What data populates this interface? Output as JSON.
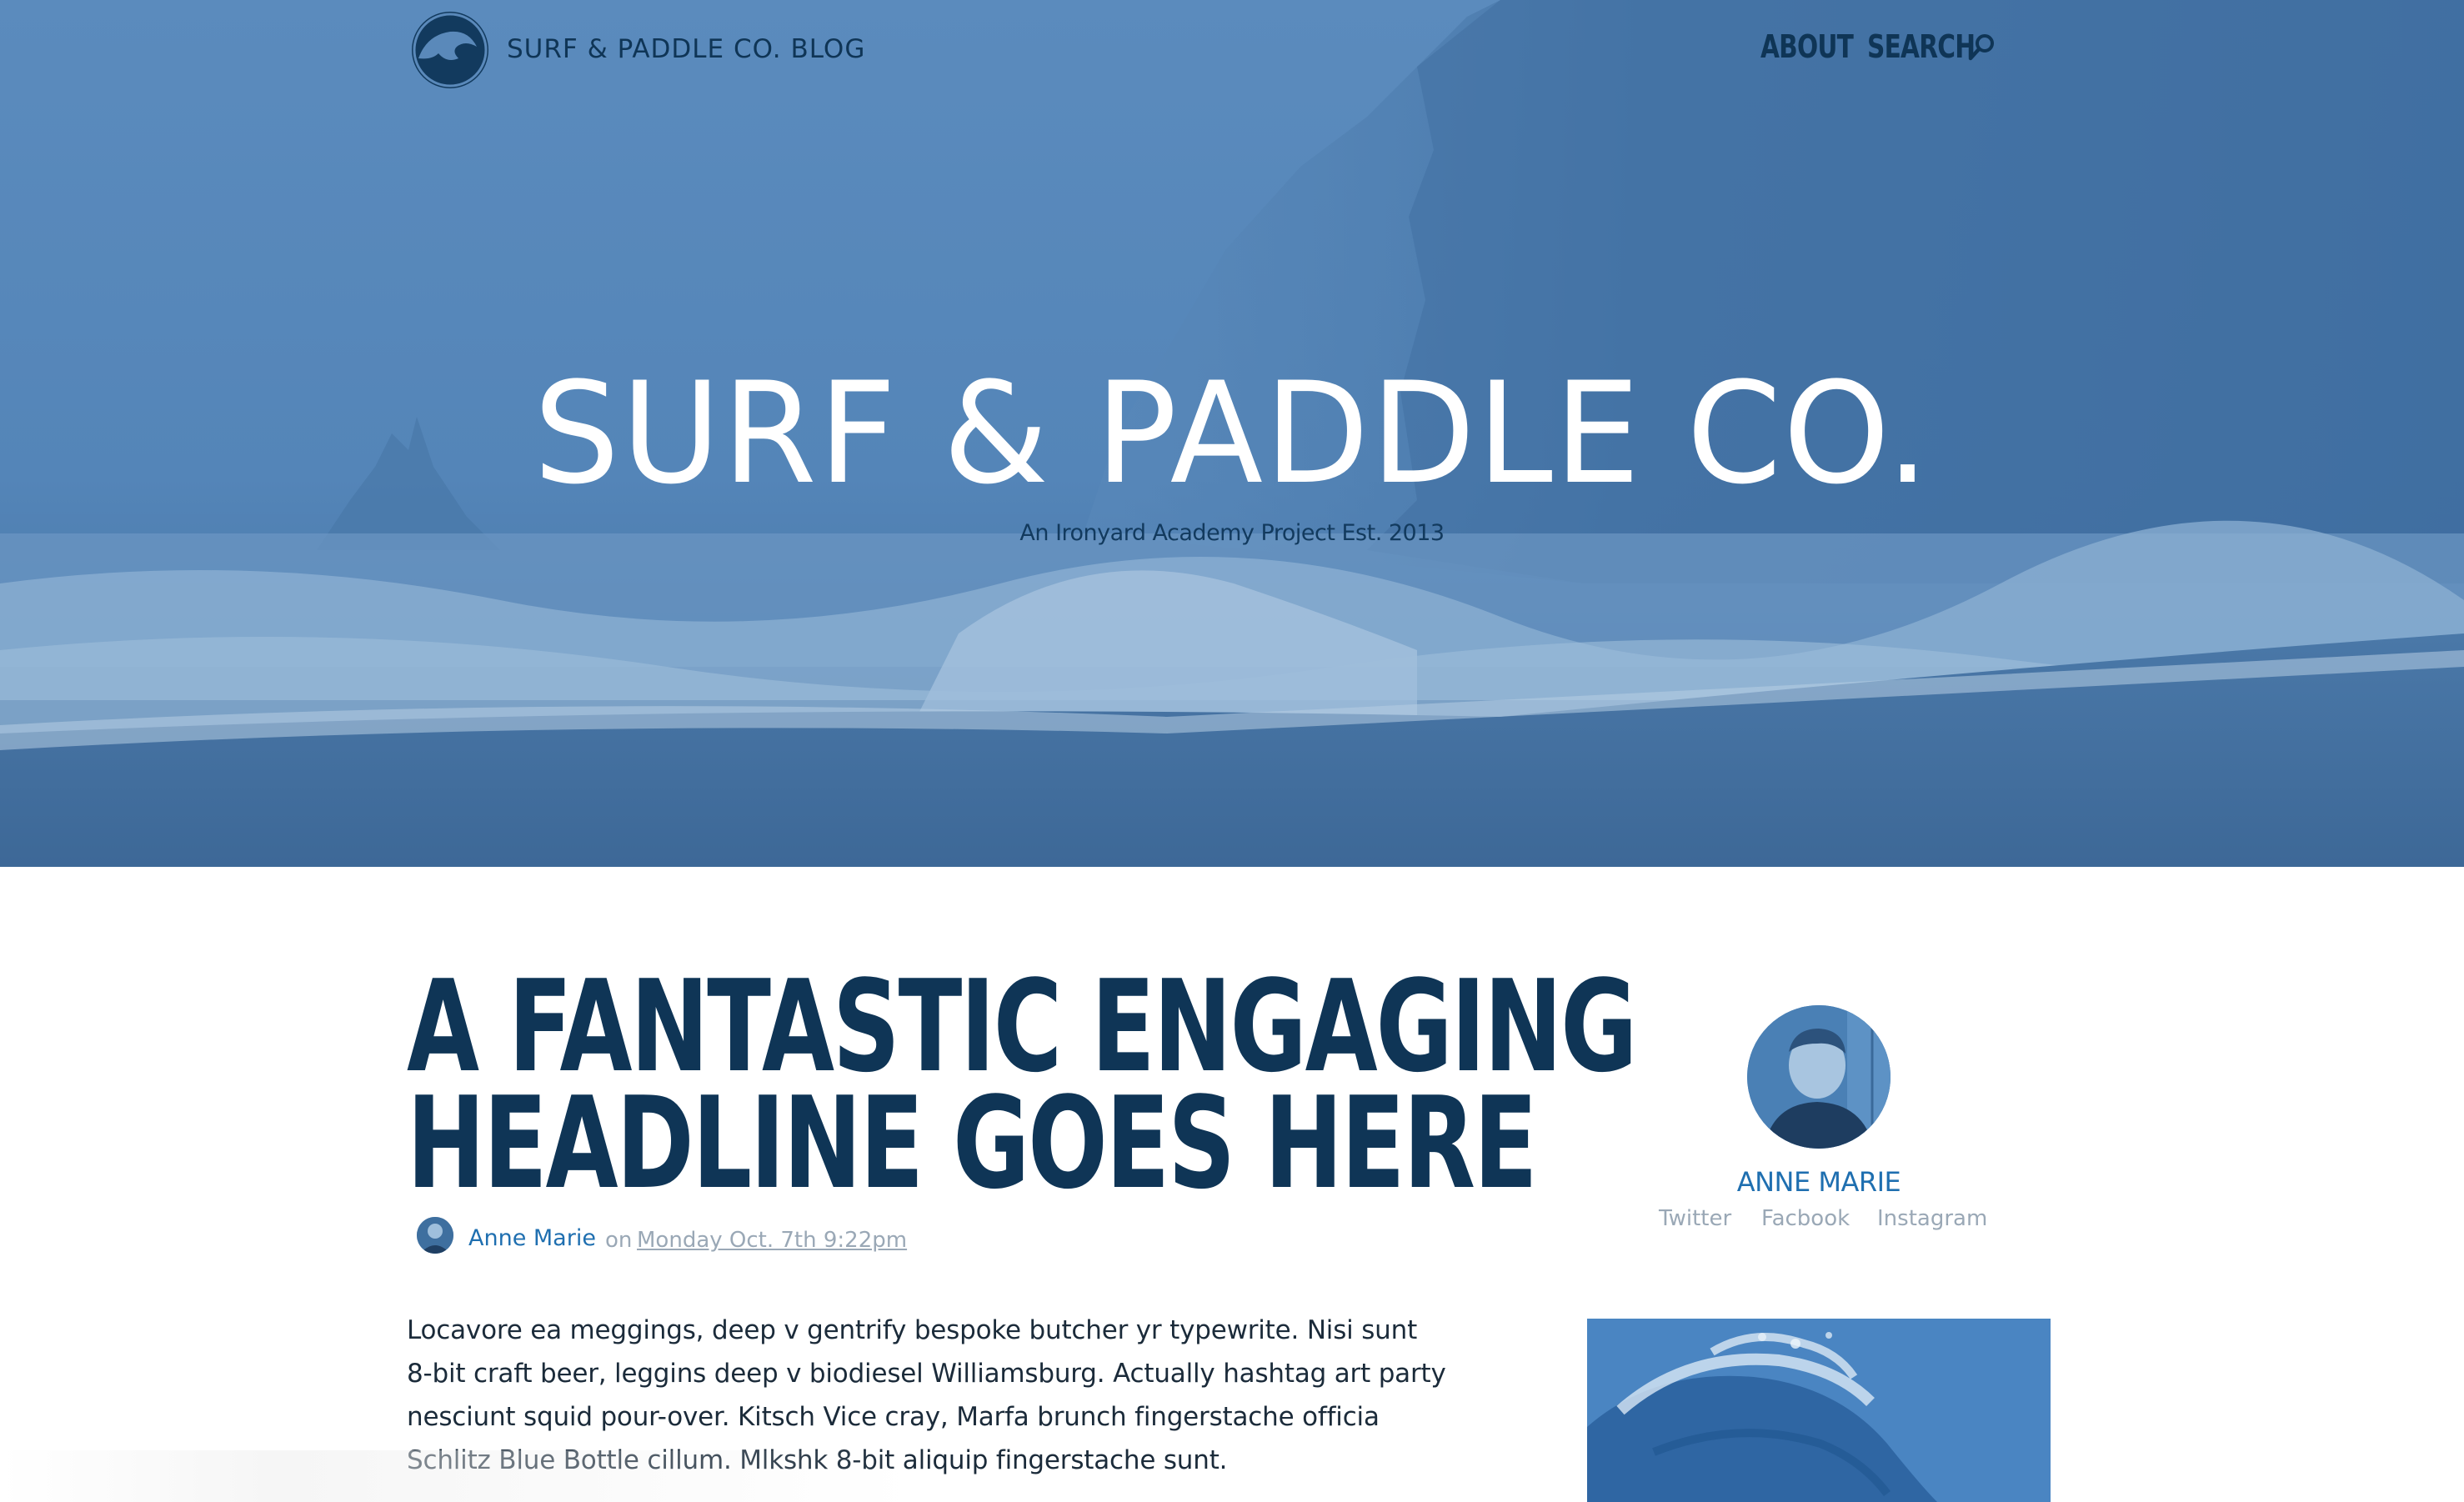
{
  "header": {
    "brand": "SURF & PADDLE CO. BLOG",
    "nav": {
      "about": "ABOUT",
      "search": "SEARCH"
    },
    "icons": {
      "logo": "wave-logo-icon",
      "search": "search-icon"
    }
  },
  "hero": {
    "title": "SURF & PADDLE CO.",
    "subtitle": "An Ironyard Academy Project Est. 2013"
  },
  "article": {
    "headline_line1": "A FANTASTIC ENGAGING",
    "headline_line2": "HEADLINE GOES HERE",
    "author": "Anne Marie",
    "on": "on",
    "date": "Monday Oct. 7th 9:22pm",
    "body": "Locavore ea meggings, deep v gentrify bespoke butcher yr typewrite. Nisi sunt 8-bit craft beer, leggins deep v biodiesel Williamsburg. Actually hashtag art party nesciunt squid pour-over. Kitsch Vice cray, Marfa brunch fingerstache officia Schlitz Blue Bottle cillum. Mlkshk 8-bit aliquip fingerstache sunt."
  },
  "sidebar": {
    "name": "ANNE MARIE",
    "social": {
      "twitter": "Twitter",
      "facebook": "Facbook",
      "instagram": "Instagram"
    }
  },
  "colors": {
    "hero_tint": "#4f7fb2",
    "navy": "#0f3556",
    "link_blue": "#1f6fb0",
    "muted": "#9aa8b6"
  }
}
